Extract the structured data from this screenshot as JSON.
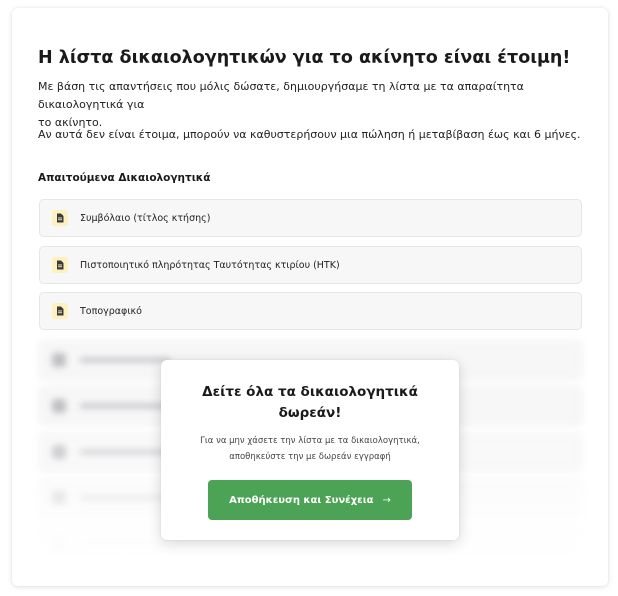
{
  "header": {
    "title": "Η λίστα δικαιολογητικών για το ακίνητο είναι έτοιμη!",
    "intro_line1": "Με βάση τις απαντήσεις που μόλις δώσατε, δημιουργήσαμε τη λίστα με τα απαραίτητα δικαιολογητικά για",
    "intro_line2": "το ακίνητο.",
    "warning": "Αν αυτά δεν είναι έτοιμα, μπορούν να καθυστερήσουν μια πώληση ή μεταβίβαση έως και 6 μήνες."
  },
  "documents": {
    "section_title": "Απαιτούμενα Δικαιολογητικά",
    "items": [
      {
        "label": "Συμβόλαιο (τίτλος κτήσης)",
        "icon": "document-icon"
      },
      {
        "label": "Πιστοποιητικό πληρότητας Ταυτότητας κτιρίου (ΗΤΚ)",
        "icon": "document-icon"
      },
      {
        "label": "Τοπογραφικό",
        "icon": "document-icon"
      }
    ],
    "locked_count": 5
  },
  "modal": {
    "title_line1": "Δείτε όλα τα δικαιολογητικά",
    "title_line2": "δωρεάν!",
    "text_line1": "Για να μην χάσετε την λίστα με τα δικαιολογητικά,",
    "text_line2": "αποθηκεύστε την με δωρεάν εγγραφή",
    "cta_label": "Αποθήκευση και Συνέχεια",
    "cta_arrow": "→"
  },
  "colors": {
    "accent_green": "#4ca255",
    "doc_icon_bg": "#fdf1bf"
  }
}
